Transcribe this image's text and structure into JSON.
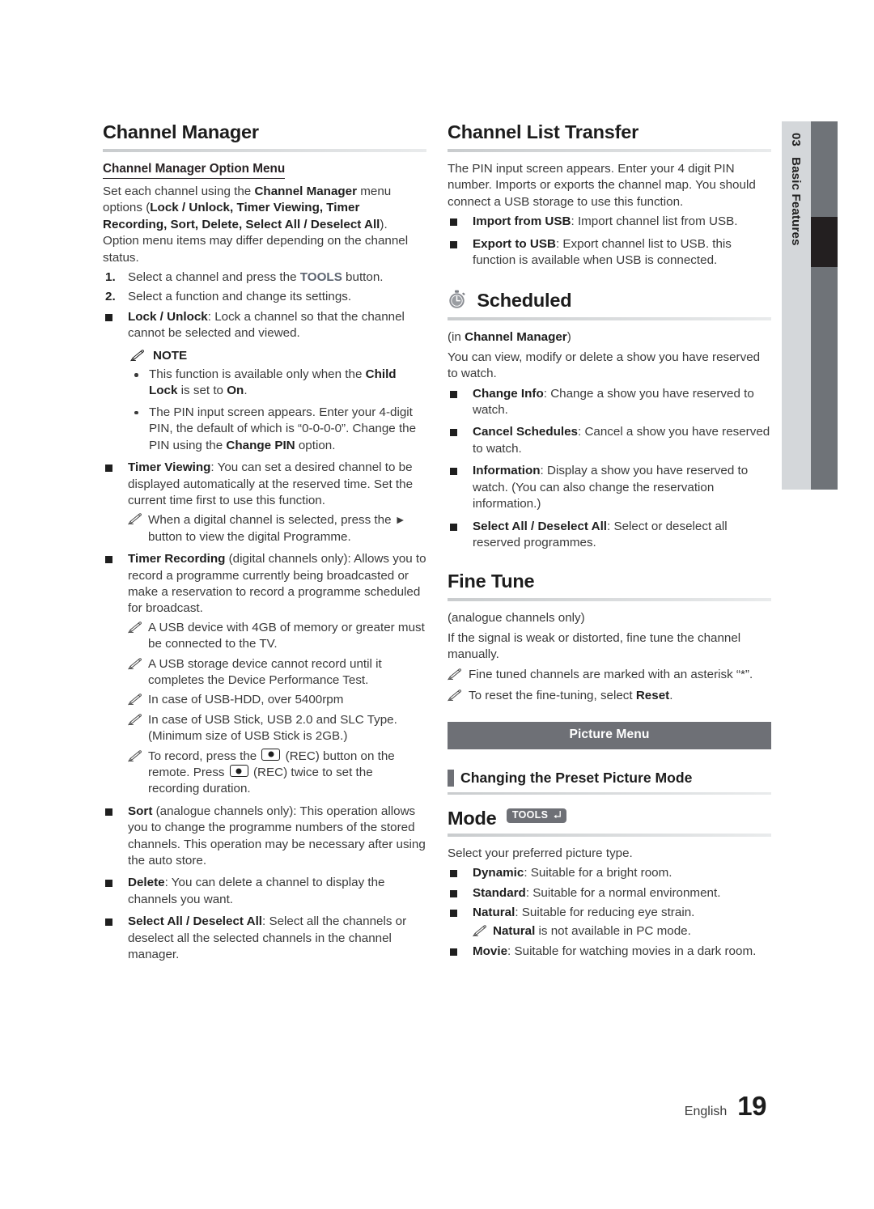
{
  "page": {
    "side_tab": {
      "number": "03",
      "label": "Basic Features"
    },
    "footer": {
      "language": "English",
      "page_number": "19"
    },
    "colors": {
      "banner": "#6e7076",
      "accent_bar": "#6e7076",
      "side_tab_bg": "#d4d7da",
      "side_bar": "#6f7378",
      "side_bar_active": "#231f20"
    }
  },
  "left": {
    "heading": "Channel Manager",
    "subheading": "Channel Manager Option Menu",
    "intro_1": "Set each channel using the ",
    "intro_b1": "Channel Manager",
    "intro_2": " menu options (",
    "intro_b2": "Lock / Unlock, Timer Viewing, Timer Recording, Sort, Delete, Select All / Deselect All",
    "intro_3": "). Option menu items may differ depending on the channel status.",
    "steps": [
      {
        "pre": "Select a channel and press the ",
        "tools": "TOOLS",
        "post": " button."
      },
      {
        "pre": "Select a function and change its settings.",
        "tools": "",
        "post": ""
      }
    ],
    "item_lock_label": "Lock / Unlock",
    "item_lock_text": ": Lock a channel so that the channel cannot be selected and viewed.",
    "note_label": "NOTE",
    "note_1a": "This function is available only when the ",
    "note_1b": "Child Lock",
    "note_1c": " is set to ",
    "note_1d": "On",
    "note_1e": ".",
    "note_2a": "The PIN input screen appears. Enter your 4-digit PIN, the default of which is “0-0-0-0”. Change the PIN using the ",
    "note_2b": "Change PIN",
    "note_2c": " option.",
    "item_timerview_label": "Timer Viewing",
    "item_timerview_text": ": You can set a desired channel to be displayed automatically at the reserved time. Set the current time first to use this function.",
    "item_timerview_note_a": "When a digital channel is selected, press the ",
    "item_timerview_note_arrow": "►",
    "item_timerview_note_b": " button to view the digital Programme.",
    "item_timerrec_label": "Timer Recording",
    "item_timerrec_text": " (digital channels only): Allows you to record a programme currently being broadcasted or make a reservation to record a programme scheduled for broadcast.",
    "timerrec_notes": [
      "A USB device with 4GB of memory or greater must be connected to the TV.",
      "A USB storage device cannot record until it completes the Device Performance Test.",
      "In case of USB-HDD, over 5400rpm",
      "In case of USB Stick, USB 2.0 and SLC Type. (Minimum size of USB Stick is 2GB.)"
    ],
    "timerrec_note_rec_a": "To record, press the ",
    "timerrec_note_rec_b": " (REC) button on the remote. Press ",
    "timerrec_note_rec_c": " (REC) twice to set the recording duration.",
    "item_sort_label": "Sort",
    "item_sort_text": " (analogue channels only): This operation allows you to change the programme numbers of the stored channels. This operation may be necessary after using the auto store.",
    "item_delete_label": "Delete",
    "item_delete_text": ": You can delete a channel to display the channels you want.",
    "item_selectall_label": "Select All / Deselect All",
    "item_selectall_text": ": Select all the channels or deselect all the selected channels in the channel manager."
  },
  "right": {
    "transfer_heading": "Channel List Transfer",
    "transfer_intro": "The PIN input screen appears. Enter your 4 digit PIN number. Imports or exports the channel map. You should connect a USB storage to use this function.",
    "transfer_items": [
      {
        "label": "Import from USB",
        "text": ": Import channel list from USB."
      },
      {
        "label": "Export to USB",
        "text": ": Export channel list to USB. this function is available when USB is connected."
      }
    ],
    "scheduled_heading": "Scheduled",
    "scheduled_sub_a": "(in ",
    "scheduled_sub_b": "Channel Manager",
    "scheduled_sub_c": ")",
    "scheduled_intro": "You can view, modify or delete a show you have reserved to watch.",
    "scheduled_items": [
      {
        "label": "Change Info",
        "text": ": Change a show you have reserved to watch."
      },
      {
        "label": "Cancel Schedules",
        "text": ": Cancel a show you have reserved to watch."
      },
      {
        "label": "Information",
        "text": ": Display a show you have reserved to watch. (You can also change the reservation information.)"
      },
      {
        "label": "Select All / Deselect All",
        "text": ": Select or deselect all reserved programmes."
      }
    ],
    "finetune_heading": "Fine Tune",
    "finetune_sub": "(analogue channels only)",
    "finetune_intro": "If the signal is weak or distorted, fine tune the channel manually.",
    "finetune_note_1": "Fine tuned channels are marked with an asterisk “*”.",
    "finetune_note_2a": "To reset the fine-tuning, select ",
    "finetune_note_2b": "Reset",
    "finetune_note_2c": ".",
    "banner": "Picture Menu",
    "preset_heading": "Changing the Preset Picture Mode",
    "mode_heading": "Mode",
    "mode_badge": "TOOLS",
    "mode_intro": "Select your preferred picture type.",
    "mode_items": [
      {
        "label": "Dynamic",
        "text": ": Suitable for a bright room."
      },
      {
        "label": "Standard",
        "text": ": Suitable for a normal environment."
      },
      {
        "label": "Natural",
        "text": ": Suitable for reducing eye strain."
      },
      {
        "label": "Movie",
        "text": ": Suitable for watching movies in a dark room."
      }
    ],
    "mode_natural_note_a": "Natural",
    "mode_natural_note_b": " is not available in PC mode."
  }
}
